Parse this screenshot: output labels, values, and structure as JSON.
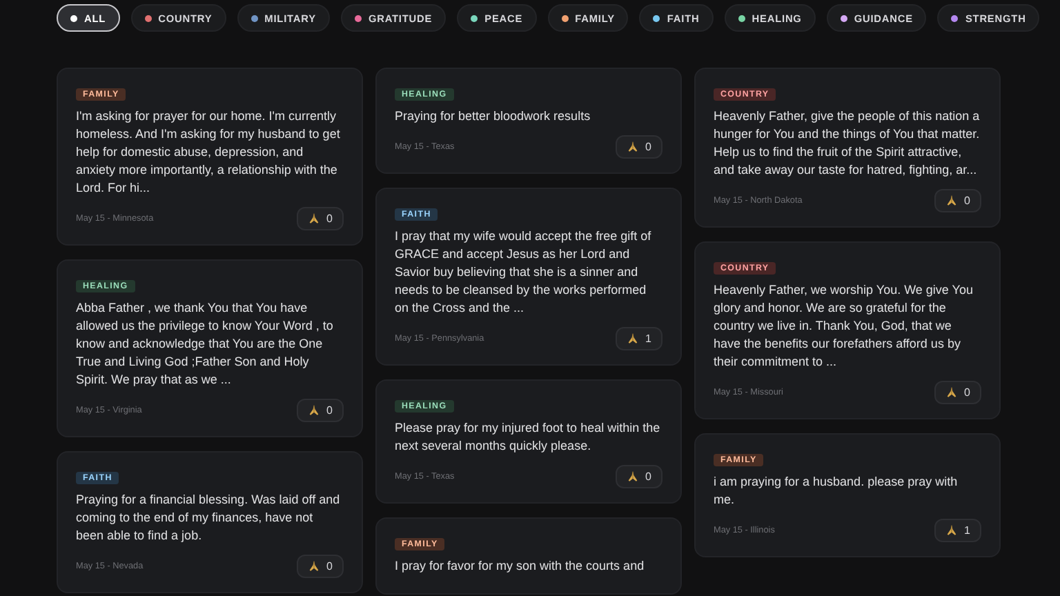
{
  "filters": [
    {
      "label": "ALL",
      "color": "#ffffff",
      "selected": true
    },
    {
      "label": "COUNTRY",
      "color": "#e07070",
      "selected": false
    },
    {
      "label": "MILITARY",
      "color": "#7094c4",
      "selected": false
    },
    {
      "label": "GRATITUDE",
      "color": "#e86a9a",
      "selected": false
    },
    {
      "label": "PEACE",
      "color": "#7ad6bc",
      "selected": false
    },
    {
      "label": "FAMILY",
      "color": "#f0a070",
      "selected": false
    },
    {
      "label": "FAITH",
      "color": "#78c8f0",
      "selected": false
    },
    {
      "label": "HEALING",
      "color": "#78d4a4",
      "selected": false
    },
    {
      "label": "GUIDANCE",
      "color": "#d4a8f4",
      "selected": false
    },
    {
      "label": "STRENGTH",
      "color": "#b488f0",
      "selected": false
    }
  ],
  "columns": [
    {
      "cards": [
        {
          "tag": "FAMILY",
          "color": "#4a2e24",
          "text": "I'm asking for prayer for our home. I'm currently homeless. And I'm asking for my husband to get help for domestic abuse, depression, and anxiety more importantly, a relationship with the Lord. For hi...",
          "meta": "May 15 - Minnesota",
          "count": "0"
        },
        {
          "tag": "HEALING",
          "color": "#24392e",
          "text": "Abba Father , we thank You that You have allowed us the privilege to know Your Word , to know and acknowledge that You are the One True and Living God ;Father Son and Holy Spirit. We pray that as we ...",
          "meta": "May 15 - Virginia",
          "count": "0"
        },
        {
          "tag": "FAITH",
          "color": "#243646",
          "text": "Praying for a financial blessing. Was laid off and coming to the end of my finances, have not been able to find a job.",
          "meta": "May 15 - Nevada",
          "count": "0"
        }
      ]
    },
    {
      "cards": [
        {
          "tag": "HEALING",
          "color": "#24392e",
          "text": "Praying for better bloodwork results",
          "meta": "May 15 - Texas",
          "count": "0"
        },
        {
          "tag": "FAITH",
          "color": "#243646",
          "text": "I pray that my wife would accept the free gift of GRACE and accept Jesus as her Lord and Savior buy believing that she is a sinner and needs to be cleansed by the works performed on the Cross and the ...",
          "meta": "May 15 - Pennsylvania",
          "count": "1"
        },
        {
          "tag": "HEALING",
          "color": "#24392e",
          "text": "Please pray for my injured foot to heal within the next several months quickly please.",
          "meta": "May 15 - Texas",
          "count": "0"
        },
        {
          "tag": "FAMILY",
          "color": "#4a2e24",
          "text": "I pray for favor for my son with the courts and"
        }
      ]
    },
    {
      "cards": [
        {
          "tag": "COUNTRY",
          "color": "#4a2626",
          "text": "Heavenly Father, give the people of this nation a hunger for You and the things of You that matter. Help us to find the fruit of the Spirit attractive, and take away our taste for hatred, fighting, ar...",
          "meta": "May 15 - North Dakota",
          "count": "0"
        },
        {
          "tag": "COUNTRY",
          "color": "#4a2626",
          "text": "Heavenly Father, we worship You. We give You glory and honor. We are so grateful for the country we live in. Thank You, God, that we have the benefits our forefathers afford us by their commitment to ...",
          "meta": "May 15 - Missouri",
          "count": "0"
        },
        {
          "tag": "FAMILY",
          "color": "#4a2e24",
          "text": "i am praying for a husband. please pray with me.",
          "meta": "May 15 - Illinois",
          "count": "1"
        }
      ]
    }
  ]
}
